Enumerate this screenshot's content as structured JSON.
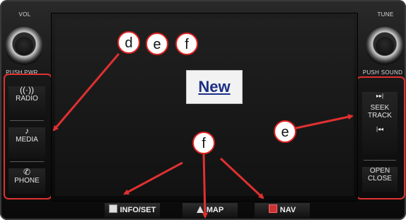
{
  "knobs": {
    "left_label_top": "VOL",
    "left_label_bottom": "PUSH PWR",
    "right_label_top": "TUNE",
    "right_label_bottom": "PUSH SOUND"
  },
  "left_buttons": [
    {
      "icon": "radio-icon",
      "glyph": "((·))",
      "label": "RADIO"
    },
    {
      "icon": "music-note-icon",
      "glyph": "♪",
      "label": "MEDIA"
    },
    {
      "icon": "phone-icon",
      "glyph": "✆",
      "label": "PHONE"
    }
  ],
  "right_buttons": {
    "seek": {
      "glyph_up": "▸▸|",
      "line1": "SEEK",
      "line2": "TRACK",
      "glyph_down": "|◂◂"
    },
    "open": {
      "line1": "OPEN",
      "line2": "CLOSE"
    }
  },
  "screen": {
    "new_label": "New"
  },
  "callouts": {
    "d": "d",
    "e_top": "e",
    "f_top": "f",
    "e_right": "e",
    "f_bottom": "f"
  },
  "bottom_buttons": [
    {
      "icon": "info-icon",
      "label": "INFO/SET"
    },
    {
      "icon": "map-arrow-icon",
      "label": "MAP"
    },
    {
      "icon": "nav-icon",
      "label": "NAV"
    }
  ],
  "colors": {
    "callout_red": "#e03030",
    "new_text": "#1c2f87"
  }
}
